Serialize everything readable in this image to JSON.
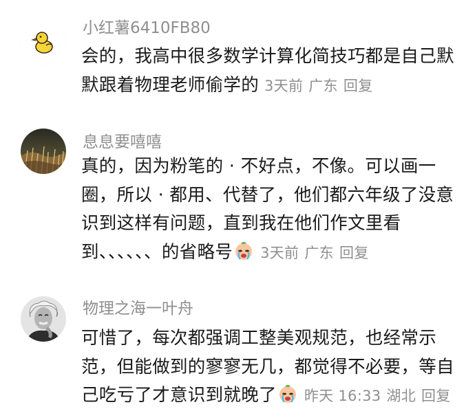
{
  "comments": [
    {
      "username": "小红薯6410FB80",
      "lines": [
        "会的，我高中很多数学计算化简技巧都是自己默",
        "默跟着物理老师偷学的"
      ],
      "has_emoji": false,
      "time": "3天前",
      "location": "广东",
      "reply_label": "回复",
      "avatar_icon": "duck-avatar-icon"
    },
    {
      "username": "息息要嘻嘻",
      "lines": [
        "真的，因为粉笔的 · 不好点，不像。可以画一",
        "圈，所以 · 都用、代替了，他们都六年级了没意",
        "识到这样有问题，直到我在他们作文里看",
        "到、、、、、、的省略号"
      ],
      "has_emoji": true,
      "emoji_icon": "crying-face-emoji-icon",
      "time": "3天前",
      "location": "广东",
      "reply_label": "回复",
      "avatar_icon": "grass-photo-avatar-icon"
    },
    {
      "username": "物理之海一叶舟",
      "lines": [
        "可惜了，每次都强调工整美观规范，也经常示",
        "范，但能做到的寥寥无几，都觉得不必要，等自",
        "己吃亏了才意识到就晚了"
      ],
      "has_emoji": true,
      "emoji_icon": "crying-face-emoji-icon",
      "time": "昨天 16:33",
      "location": "湖北",
      "reply_label": "回复",
      "avatar_icon": "einstein-portrait-avatar-icon"
    }
  ]
}
